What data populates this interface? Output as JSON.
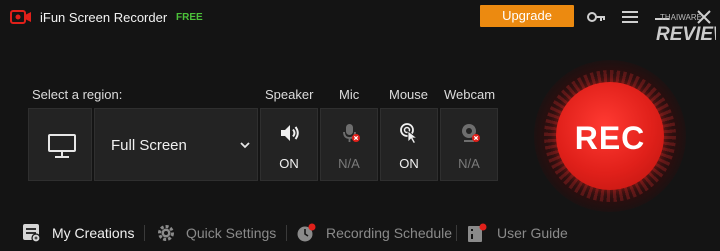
{
  "titlebar": {
    "app_name": "iFun Screen Recorder",
    "badge": "FREE",
    "upgrade_label": "Upgrade",
    "watermark_top": "THAIWARE",
    "watermark_bottom": "REVIEW"
  },
  "region": {
    "label": "Select a region:",
    "selected": "Full Screen"
  },
  "sources": [
    {
      "label": "Speaker",
      "status": "ON",
      "icon": "speaker-icon"
    },
    {
      "label": "Mic",
      "status": "N/A",
      "icon": "mic-disabled-icon"
    },
    {
      "label": "Mouse",
      "status": "ON",
      "icon": "mouse-click-icon"
    },
    {
      "label": "Webcam",
      "status": "N/A",
      "icon": "webcam-disabled-icon"
    }
  ],
  "rec_label": "REC",
  "footer": {
    "my_creations": "My Creations",
    "quick_settings": "Quick Settings",
    "recording_schedule": "Recording Schedule",
    "user_guide": "User Guide"
  },
  "colors": {
    "accent_orange": "#ec8a10",
    "rec_red": "#e0201a",
    "free_green": "#4cc23a",
    "notify_red": "#e0201a"
  }
}
